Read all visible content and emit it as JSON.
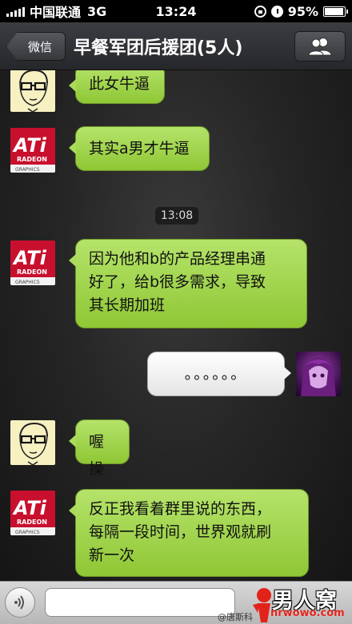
{
  "status_bar": {
    "carrier": "中国联通",
    "network": "3G",
    "time": "13:24",
    "battery": "95%",
    "battery_level": 0.95
  },
  "nav": {
    "back_label": "微信",
    "title": "早餐军团后援团(5人)",
    "members_icon": "people-icon"
  },
  "messages": [
    {
      "sender": "glasses-avatar",
      "side": "left",
      "text": "此女牛逼"
    },
    {
      "sender": "ati-avatar",
      "side": "left",
      "text": "其实a男才牛逼"
    },
    {
      "sender": "ati-avatar",
      "side": "left",
      "text": "因为他和b的产品经理串通\n好了，给b很多需求，导致\n其长期加班"
    },
    {
      "sender": "purple-avatar",
      "side": "right",
      "text": "。。。。。。"
    },
    {
      "sender": "glasses-avatar",
      "side": "left",
      "text": "喔操"
    },
    {
      "sender": "ati-avatar",
      "side": "left",
      "text": "反正我看着群里说的东西，\n每隔一段时间，世界观就刷\n新一次"
    }
  ],
  "timestamp": "13:08",
  "avatar_ati": {
    "brand": "ATi",
    "sub": "RADEON",
    "tagline": "GRAPHICS"
  },
  "input_bar": {
    "placeholder": "",
    "voice_icon": "voice-icon"
  },
  "watermark": {
    "brand": "男人窝",
    "url": "nrwowo.com",
    "credit": "@唐斯科"
  },
  "colors": {
    "bubble_green": "#a9dc5a",
    "bubble_white": "#f3f3f3",
    "ati_red": "#c8102e"
  }
}
